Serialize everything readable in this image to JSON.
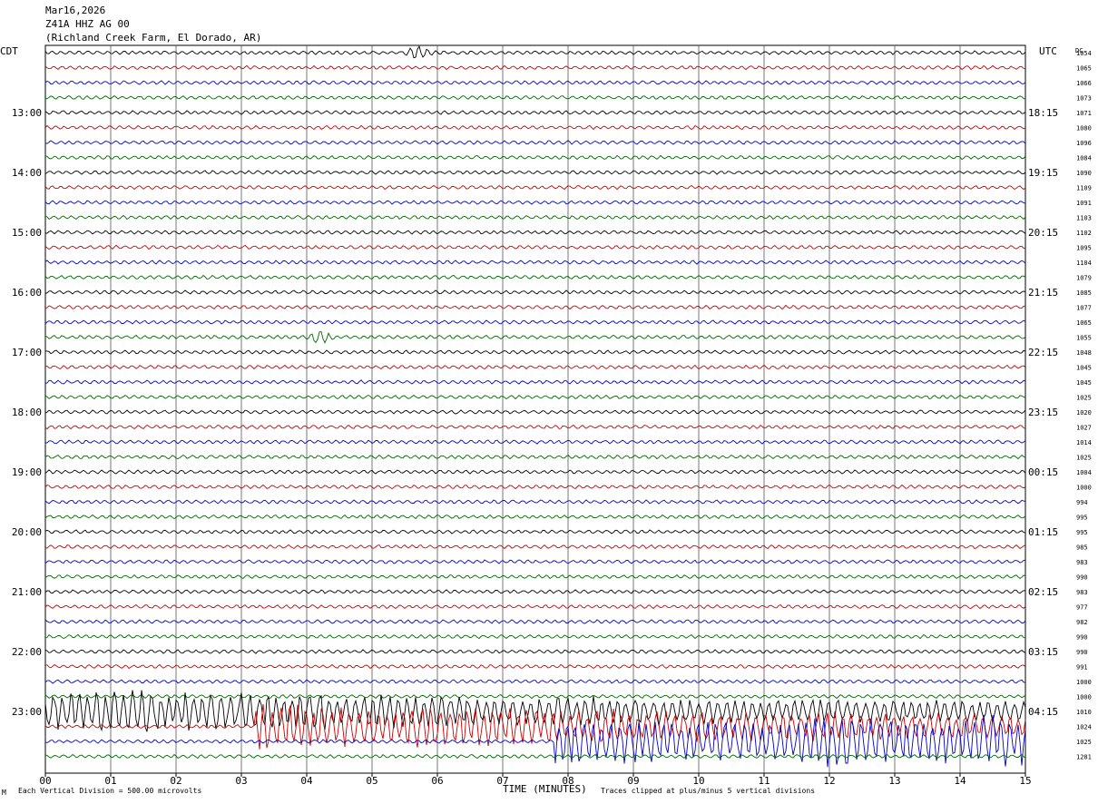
{
  "header": {
    "date": "Mar16,2026",
    "station": "Z41A HHZ AG 00",
    "location": "(Richland Creek Farm, El Dorado, AR)"
  },
  "chart_data": {
    "type": "line",
    "left_timezone": "CDT",
    "right_timezone": "UTC",
    "right_corner_label": "DC",
    "xlabel": "TIME (MINUTES)",
    "x_ticks": [
      "00",
      "01",
      "02",
      "03",
      "04",
      "05",
      "06",
      "07",
      "08",
      "09",
      "10",
      "11",
      "12",
      "13",
      "14",
      "15"
    ],
    "xlim": [
      0,
      15
    ],
    "left_hour_labels": [
      "13:00",
      "14:00",
      "15:00",
      "16:00",
      "17:00",
      "18:00",
      "19:00",
      "20:00",
      "21:00",
      "22:00",
      "23:00"
    ],
    "right_hour_labels": [
      "18:15",
      "19:15",
      "20:15",
      "21:15",
      "22:15",
      "23:15",
      "00:15",
      "01:15",
      "02:15",
      "03:15",
      "04:15"
    ],
    "trace_colors": [
      "#000000",
      "#cc0000",
      "#0000cc",
      "#006600"
    ],
    "dc_offsets": [
      1054,
      1065,
      1066,
      1073,
      1071,
      1080,
      1096,
      1084,
      1090,
      1109,
      1091,
      1103,
      1102,
      1095,
      1104,
      1079,
      1085,
      1077,
      1065,
      1055,
      1048,
      1045,
      1045,
      1025,
      1020,
      1027,
      1014,
      1025,
      1004,
      1000,
      994,
      995,
      995,
      985,
      983,
      990,
      983,
      977,
      982,
      990,
      990,
      991,
      1000,
      1000,
      1010,
      1024,
      1025,
      1281
    ],
    "events": [
      {
        "trace": 0,
        "minute": 5.7,
        "level": "small"
      },
      {
        "trace": 19,
        "minute": 4.2,
        "level": "small"
      },
      {
        "trace": 44,
        "minute": 0.0,
        "level": "large"
      },
      {
        "trace": 45,
        "minute": 3.2,
        "level": "large"
      },
      {
        "trace": 46,
        "minute": 7.8,
        "level": "large"
      }
    ]
  },
  "footer": {
    "scale_note": "Each Vertical Division = 500.00 microvolts",
    "clip_note": "Traces clipped at plus/minus 5 vertical divisions",
    "corner_mark": "M"
  }
}
